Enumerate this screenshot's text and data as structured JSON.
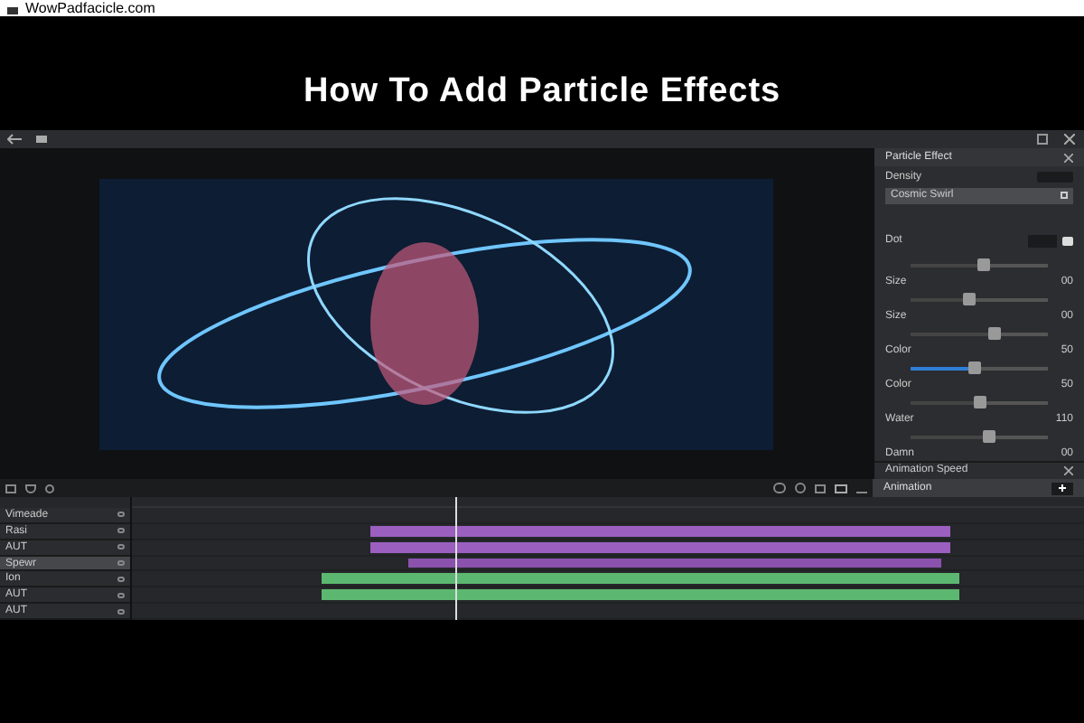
{
  "browser": {
    "address": "WowPadfacicle.com"
  },
  "headline": "How To Add Particle Effects",
  "panel": {
    "title": "Particle Effect",
    "density_label": "Density",
    "preset": "Cosmic Swirl",
    "emitter_label": "Dot",
    "controls": [
      {
        "kind": "slider",
        "level": 0.53,
        "active": false
      },
      {
        "kind": "value",
        "label": "Size",
        "value": "00"
      },
      {
        "kind": "slider",
        "level": 0.42,
        "active": false
      },
      {
        "kind": "value",
        "label": "Size",
        "value": "00"
      },
      {
        "kind": "slider",
        "level": 0.6,
        "active": false
      },
      {
        "kind": "value",
        "label": "Color",
        "value": "50"
      },
      {
        "kind": "slider",
        "level": 0.46,
        "active": true
      },
      {
        "kind": "value",
        "label": "Color",
        "value": "50"
      },
      {
        "kind": "slider",
        "level": 0.5,
        "active": false
      },
      {
        "kind": "value",
        "label": "Water",
        "value": "110"
      },
      {
        "kind": "slider",
        "level": 0.57,
        "active": false
      },
      {
        "kind": "value",
        "label": "Damn",
        "value": "00"
      }
    ],
    "section": "Animation Speed",
    "section_row": "Animation"
  },
  "tracks": [
    {
      "name": "Vimeade",
      "selected": false
    },
    {
      "name": "Rasi",
      "selected": false
    },
    {
      "name": "AUT",
      "selected": false
    },
    {
      "name": "Spewr",
      "selected": true
    },
    {
      "name": "Ion",
      "selected": false
    },
    {
      "name": "AUT",
      "selected": false
    },
    {
      "name": "AUT",
      "selected": false
    }
  ],
  "clips": [
    {
      "color": "#9b5fc0"
    },
    {
      "color": "#9b5fc0"
    },
    {
      "color": "#8a52ad"
    },
    {
      "color": "#5cb870"
    },
    {
      "color": "#5cb870"
    }
  ]
}
